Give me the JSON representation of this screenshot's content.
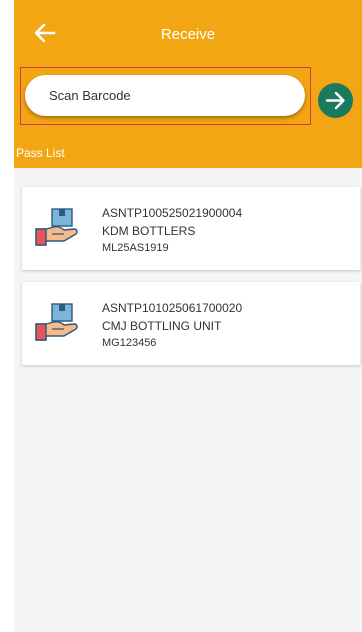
{
  "header": {
    "title": "Receive",
    "back_icon": "arrow-left-icon",
    "background_color": "#f2a614"
  },
  "search": {
    "placeholder": "Scan Barcode",
    "value": "",
    "submit_icon": "arrow-right-circle-icon",
    "submit_color": "#1a7a5e"
  },
  "pass_list": {
    "title": "Pass List",
    "items": [
      {
        "icon": "hand-package-icon",
        "asn": "ASNTP100525021900004",
        "name": "KDM BOTTLERS",
        "code": "ML25AS1919"
      },
      {
        "icon": "hand-package-icon",
        "asn": "ASNTP101025061700020",
        "name": "CMJ BOTTLING UNIT",
        "code": "MG123456"
      }
    ]
  }
}
